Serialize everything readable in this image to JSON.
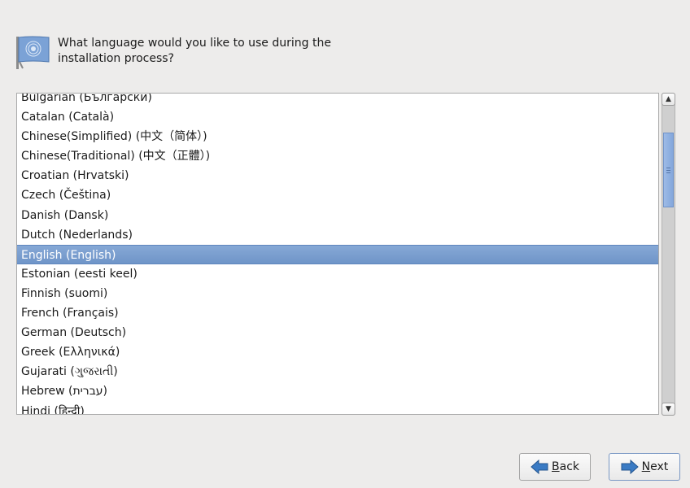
{
  "header": {
    "icon": "language-flag-icon",
    "question": "What language would you like to use during the installation process?"
  },
  "language_list": {
    "selected": "English (English)",
    "items": [
      "Bulgarian (Български)",
      "Catalan (Català)",
      "Chinese(Simplified) (中文（简体）)",
      "Chinese(Traditional) (中文（正體）)",
      "Croatian (Hrvatski)",
      "Czech (Čeština)",
      "Danish (Dansk)",
      "Dutch (Nederlands)",
      "English (English)",
      "Estonian (eesti keel)",
      "Finnish (suomi)",
      "French (Français)",
      "German (Deutsch)",
      "Greek (Ελληνικά)",
      "Gujarati (ગુજરાતી)",
      "Hebrew (עברית)",
      "Hindi (हिन्दी)"
    ]
  },
  "scrollbar": {
    "up_icon": "▲",
    "down_icon": "▼"
  },
  "buttons": {
    "back": {
      "mnemonic": "B",
      "rest": "ack",
      "icon": "arrow-left-icon"
    },
    "next": {
      "mnemonic": "N",
      "rest": "ext",
      "icon": "arrow-right-icon"
    }
  },
  "colors": {
    "selection": "#7a9ed0",
    "arrow": "#2f6fb3"
  }
}
